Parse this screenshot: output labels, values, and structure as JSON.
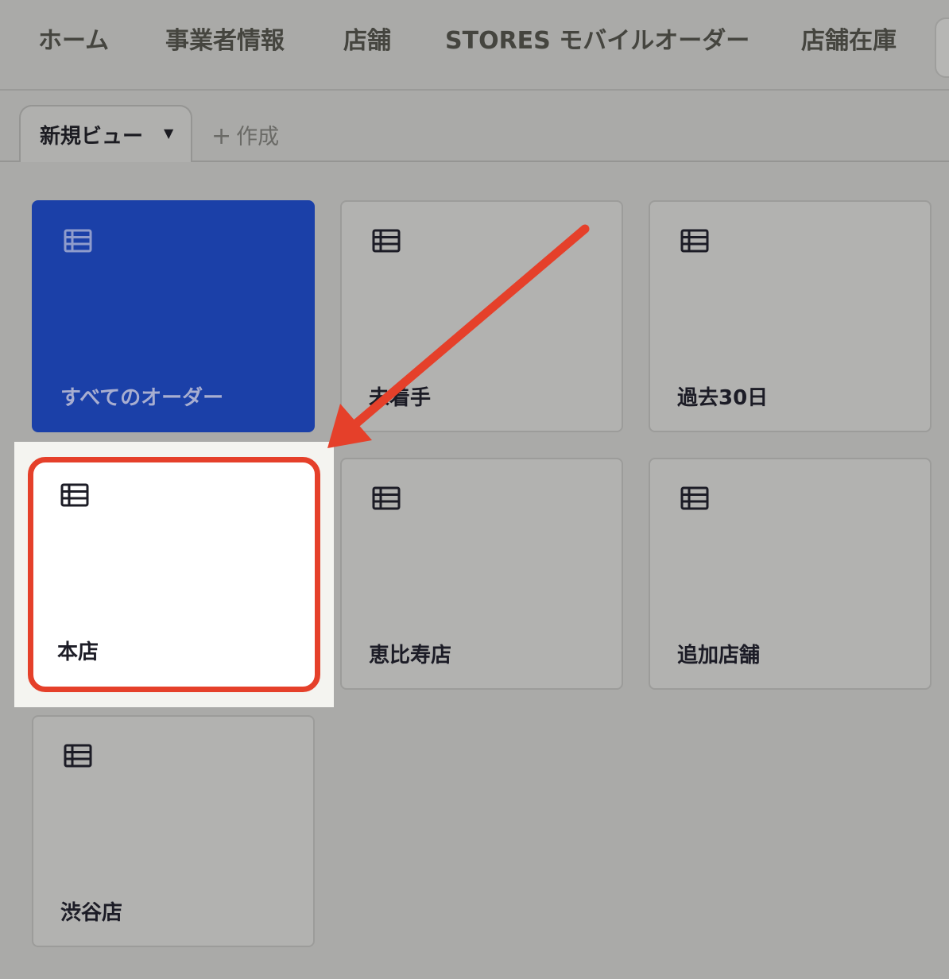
{
  "nav": {
    "items": [
      {
        "id": "home",
        "label": "ホーム"
      },
      {
        "id": "business",
        "label": "事業者情報"
      },
      {
        "id": "stores",
        "label": "店舗"
      },
      {
        "id": "mobile-order",
        "label": "STORES モバイルオーダー"
      },
      {
        "id": "inventory",
        "label": "店舗在庫"
      }
    ]
  },
  "tabs": {
    "current_view": "新規ビュー",
    "create_label": "作成"
  },
  "cards": [
    {
      "id": "all-orders",
      "label": "すべてのオーダー",
      "state": "selected"
    },
    {
      "id": "not-started",
      "label": "未着手",
      "state": "normal"
    },
    {
      "id": "last-30-days",
      "label": "過去30日",
      "state": "normal"
    },
    {
      "id": "main-store",
      "label": "本店",
      "state": "highlighted"
    },
    {
      "id": "ebisu-store",
      "label": "恵比寿店",
      "state": "normal"
    },
    {
      "id": "additional-store",
      "label": "追加店舗",
      "state": "normal"
    },
    {
      "id": "shibuya-store",
      "label": "渋谷店",
      "state": "normal"
    }
  ],
  "colors": {
    "selected_card": "#1b40a8",
    "annotation": "#e5402a",
    "background": "#aaaaa8"
  }
}
